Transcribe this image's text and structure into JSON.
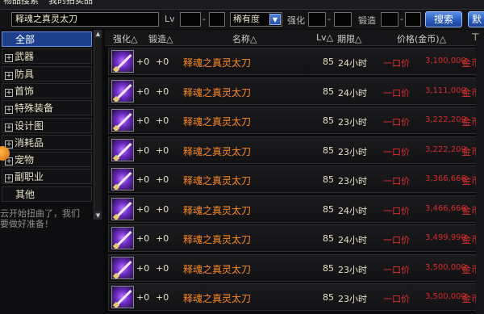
{
  "top_tabs": [
    "物品搜索",
    "我的拍卖品"
  ],
  "search": {
    "value": "释魂之真灵太刀",
    "lv_label": "Lv",
    "dash": "-",
    "rarity_value": "稀有度",
    "enhance_label": "强化",
    "forge_label": "锻造",
    "search_button": "搜索",
    "default_button": "默"
  },
  "sidebar": {
    "items": [
      {
        "label": "全部",
        "expandable": false,
        "active": true
      },
      {
        "label": "武器",
        "expandable": true,
        "active": false
      },
      {
        "label": "防具",
        "expandable": true,
        "active": false
      },
      {
        "label": "首饰",
        "expandable": true,
        "active": false
      },
      {
        "label": "特殊装备",
        "expandable": true,
        "active": false
      },
      {
        "label": "设计图",
        "expandable": true,
        "active": false
      },
      {
        "label": "消耗品",
        "expandable": true,
        "active": false
      },
      {
        "label": "宠物",
        "expandable": true,
        "active": false
      },
      {
        "label": "副职业",
        "expandable": true,
        "active": false
      },
      {
        "label": "其他",
        "expandable": false,
        "active": false
      }
    ],
    "background_text_1": "云开始扭曲了，我们",
    "background_text_2": "要做好准备！"
  },
  "table": {
    "headers": {
      "enhance": "强化△",
      "forge": "锻造△",
      "name": "名称△",
      "lv": "Lv△",
      "period": "期限△",
      "price": "价格(金币)△"
    },
    "rows": [
      {
        "enhance": "+0",
        "forge": "+0",
        "name": "释魂之真灵太刀",
        "lv": "85",
        "period": "24小时",
        "buy": "一口价",
        "price": "3,100,000",
        "unit": "金币"
      },
      {
        "enhance": "+0",
        "forge": "+0",
        "name": "释魂之真灵太刀",
        "lv": "85",
        "period": "24小时",
        "buy": "一口价",
        "price": "3,111,000",
        "unit": "金币"
      },
      {
        "enhance": "+0",
        "forge": "+0",
        "name": "释魂之真灵太刀",
        "lv": "85",
        "period": "23小时",
        "buy": "一口价",
        "price": "3,222,209",
        "unit": "金币"
      },
      {
        "enhance": "+0",
        "forge": "+0",
        "name": "释魂之真灵太刀",
        "lv": "85",
        "period": "23小时",
        "buy": "一口价",
        "price": "3,222,209",
        "unit": "金币"
      },
      {
        "enhance": "+0",
        "forge": "+0",
        "name": "释魂之真灵太刀",
        "lv": "85",
        "period": "23小时",
        "buy": "一口价",
        "price": "3,366,666",
        "unit": "金币"
      },
      {
        "enhance": "+0",
        "forge": "+0",
        "name": "释魂之真灵太刀",
        "lv": "85",
        "period": "24小时",
        "buy": "一口价",
        "price": "3,466,666",
        "unit": "金币"
      },
      {
        "enhance": "+0",
        "forge": "+0",
        "name": "释魂之真灵太刀",
        "lv": "85",
        "period": "24小时",
        "buy": "一口价",
        "price": "3,499,990",
        "unit": "金币"
      },
      {
        "enhance": "+0",
        "forge": "+0",
        "name": "释魂之真灵太刀",
        "lv": "85",
        "period": "23小时",
        "buy": "一口价",
        "price": "3,500,000",
        "unit": "金币"
      },
      {
        "enhance": "+0",
        "forge": "+0",
        "name": "释魂之真灵太刀",
        "lv": "85",
        "period": "23小时",
        "buy": "一口价",
        "price": "3,500,000",
        "unit": "金币"
      }
    ]
  },
  "colors": {
    "item_name": "#ff8a1e",
    "price_red": "#d42a2a",
    "active_category": "#1d3f8c",
    "button_blue": "#2b5cc0"
  },
  "icons": {
    "item": "sword-item-icon",
    "pin": "pin-icon",
    "dropdown": "chevron-down-icon"
  }
}
